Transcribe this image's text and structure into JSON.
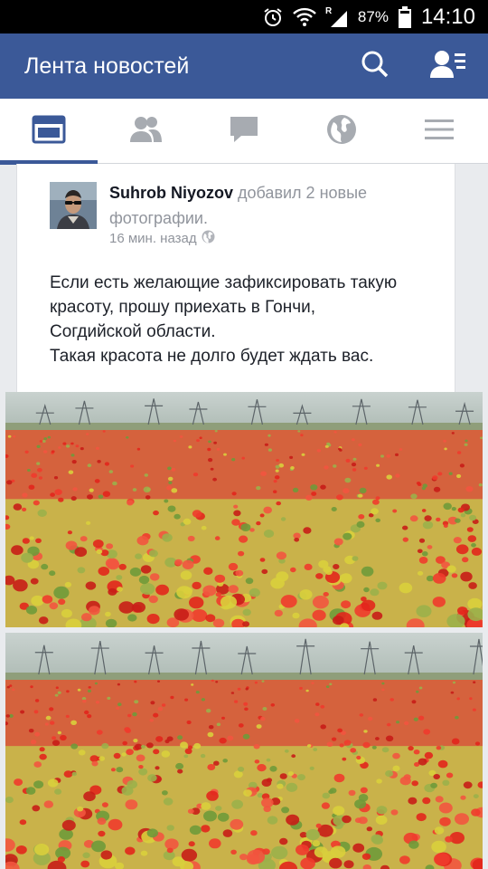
{
  "status_bar": {
    "battery_percent": "87%",
    "time": "14:10",
    "network_letter": "R",
    "icons": [
      "alarm-icon",
      "wifi-icon",
      "signal-icon",
      "battery-icon"
    ]
  },
  "app_bar": {
    "title": "Лента новостей",
    "actions": [
      "search-icon",
      "friend-requests-icon"
    ],
    "color": "#3b5998"
  },
  "tabs": {
    "items": [
      "news-feed-icon",
      "friends-icon",
      "messages-icon",
      "notifications-globe-icon",
      "menu-icon"
    ],
    "active_index": 0
  },
  "post": {
    "author": "Suhrob Niyozov",
    "action_line1": " добавил 2 новые",
    "action_line2": "фотографии.",
    "time_ago": "16 мин. назад",
    "privacy_icon": "globe-icon",
    "text_lines": [
      "Если есть желающие зафиксировать такую",
      "красоту, прошу приехать в Гончи,",
      "Согдийской области.",
      "Такая красота не долго будет ждать вас."
    ]
  },
  "photos": [
    {
      "subject": "poppy field with power lines"
    },
    {
      "subject": "poppy field with power lines"
    }
  ]
}
